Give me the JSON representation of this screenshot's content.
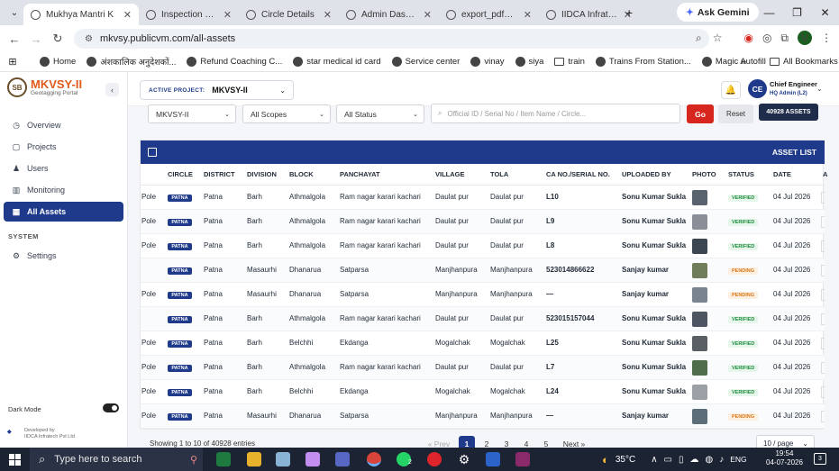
{
  "browser": {
    "tabs": [
      {
        "title": "Mukhya Mantri K",
        "active": true
      },
      {
        "title": "Inspection Data E",
        "active": false
      },
      {
        "title": "Circle Details",
        "active": false
      },
      {
        "title": "Admin Dashboar",
        "active": false
      },
      {
        "title": "export_pdf_waive",
        "active": false
      },
      {
        "title": "IIDCA Infratech P",
        "active": false
      }
    ],
    "new_tab_icon": "plus-icon",
    "gemini_label": "Ask Gemini",
    "url": "mkvsy.publicvm.com/all-assets",
    "profile_initial": "V",
    "bookmarks": [
      {
        "label": "Home",
        "icon": "globe"
      },
      {
        "label": "अंशकालिक अनुदेशकों...",
        "icon": "globe"
      },
      {
        "label": "Refund Coaching C...",
        "icon": "globe"
      },
      {
        "label": "star medical id card",
        "icon": "globe"
      },
      {
        "label": "Service center",
        "icon": "globe"
      },
      {
        "label": "vinay",
        "icon": "globe"
      },
      {
        "label": "siya",
        "icon": "globe"
      },
      {
        "label": "train",
        "icon": "folder"
      },
      {
        "label": "Trains From Station...",
        "icon": "globe"
      },
      {
        "label": "Magic Autofill",
        "icon": "globe"
      }
    ],
    "all_bookmarks": "All Bookmarks"
  },
  "app": {
    "logo_mark": "SB",
    "logo_name": "MKVSY-II",
    "logo_sub": "Geotagging Portal",
    "nav": [
      {
        "label": "Overview",
        "icon": "grid-icon",
        "active": false
      },
      {
        "label": "Projects",
        "icon": "folder-icon",
        "active": false
      },
      {
        "label": "Users",
        "icon": "users-icon",
        "active": false
      },
      {
        "label": "Monitoring",
        "icon": "chart-icon",
        "active": false
      },
      {
        "label": "All Assets",
        "icon": "layers-icon",
        "active": true
      }
    ],
    "system_section": "SYSTEM",
    "settings_label": "Settings",
    "dark_mode_label": "Dark Mode",
    "dev_line1": "Developed by",
    "dev_line2": "IIDCA Infratech Pvt Ltd",
    "active_project_label": "ACTIVE PROJECT:",
    "active_project_value": "MKVSY-II",
    "user_initials": "CE",
    "user_name": "Chief Engineer",
    "user_role": "HQ Admin (L2)"
  },
  "filters": {
    "project": "MKVSY-II",
    "scopes": "All Scopes",
    "status": "All Status",
    "search_placeholder": "Official ID / Serial No / Item Name / Circle...",
    "go_label": "Go",
    "reset_label": "Reset",
    "count_badge": "40928 ASSETS"
  },
  "table": {
    "title": "ASSET LIST",
    "columns": [
      "CIRCLE",
      "DISTRICT",
      "DIVISION",
      "BLOCK",
      "PANCHAYAT",
      "VILLAGE",
      "TOLA",
      "CA NO./SERIAL NO.",
      "UPLOADED BY",
      "PHOTO",
      "STATUS",
      "DATE",
      "A"
    ],
    "rows": [
      {
        "lead": "Pole",
        "circle": "PATNA",
        "district": "Patna",
        "division": "Barh",
        "block": "Athmalgola",
        "panchayat": "Ram nagar karari kachari",
        "village": "Daulat pur",
        "tola": "Daulat pur",
        "serial": "L10",
        "uploader": "Sonu Kumar Sukla",
        "status": "VERIFIED",
        "date": "04 Jul 2026"
      },
      {
        "lead": "Pole",
        "circle": "PATNA",
        "district": "Patna",
        "division": "Barh",
        "block": "Athmalgola",
        "panchayat": "Ram nagar karari kachari",
        "village": "Daulat pur",
        "tola": "Daulat pur",
        "serial": "L9",
        "uploader": "Sonu Kumar Sukla",
        "status": "VERIFIED",
        "date": "04 Jul 2026"
      },
      {
        "lead": "Pole",
        "circle": "PATNA",
        "district": "Patna",
        "division": "Barh",
        "block": "Athmalgola",
        "panchayat": "Ram nagar karari kachari",
        "village": "Daulat pur",
        "tola": "Daulat pur",
        "serial": "L8",
        "uploader": "Sonu Kumar Sukla",
        "status": "VERIFIED",
        "date": "04 Jul 2026"
      },
      {
        "lead": "",
        "circle": "PATNA",
        "district": "Patna",
        "division": "Masaurhi",
        "block": "Dhanarua",
        "panchayat": "Satparsa",
        "village": "Manjhanpura",
        "tola": "Manjhanpura",
        "serial": "523014866622",
        "uploader": "Sanjay kumar",
        "status": "PENDING",
        "date": "04 Jul 2026"
      },
      {
        "lead": "Pole",
        "circle": "PATNA",
        "district": "Patna",
        "division": "Masaurhi",
        "block": "Dhanarua",
        "panchayat": "Satparsa",
        "village": "Manjhanpura",
        "tola": "Manjhanpura",
        "serial": "—",
        "uploader": "Sanjay kumar",
        "status": "PENDING",
        "date": "04 Jul 2026"
      },
      {
        "lead": "",
        "circle": "PATNA",
        "district": "Patna",
        "division": "Barh",
        "block": "Athmalgola",
        "panchayat": "Ram nagar karari kachari",
        "village": "Daulat pur",
        "tola": "Daulat pur",
        "serial": "523015157044",
        "uploader": "Sonu Kumar Sukla",
        "status": "VERIFIED",
        "date": "04 Jul 2026"
      },
      {
        "lead": "Pole",
        "circle": "PATNA",
        "district": "Patna",
        "division": "Barh",
        "block": "Belchhi",
        "panchayat": "Ekdanga",
        "village": "Mogalchak",
        "tola": "Mogalchak",
        "serial": "L25",
        "uploader": "Sonu Kumar Sukla",
        "status": "VERIFIED",
        "date": "04 Jul 2026"
      },
      {
        "lead": "Pole",
        "circle": "PATNA",
        "district": "Patna",
        "division": "Barh",
        "block": "Athmalgola",
        "panchayat": "Ram nagar karari kachari",
        "village": "Daulat pur",
        "tola": "Daulat pur",
        "serial": "L7",
        "uploader": "Sonu Kumar Sukla",
        "status": "VERIFIED",
        "date": "04 Jul 2026"
      },
      {
        "lead": "Pole",
        "circle": "PATNA",
        "district": "Patna",
        "division": "Barh",
        "block": "Belchhi",
        "panchayat": "Ekdanga",
        "village": "Mogalchak",
        "tola": "Mogalchak",
        "serial": "L24",
        "uploader": "Sonu Kumar Sukla",
        "status": "VERIFIED",
        "date": "04 Jul 2026"
      },
      {
        "lead": "Pole",
        "circle": "PATNA",
        "district": "Patna",
        "division": "Masaurhi",
        "block": "Dhanarua",
        "panchayat": "Satparsa",
        "village": "Manjhanpura",
        "tola": "Manjhanpura",
        "serial": "—",
        "uploader": "Sanjay kumar",
        "status": "PENDING",
        "date": "04 Jul 2026"
      }
    ],
    "footer_info": "Showing 1 to 10 of 40928 entries",
    "pager": {
      "prev": "« Prev",
      "pages": [
        "1",
        "2",
        "3",
        "4",
        "5"
      ],
      "next": "Next »",
      "current": "1"
    },
    "per_page": "10 / page"
  },
  "taskbar": {
    "search_placeholder": "Type here to search",
    "weather": "35°C",
    "lang": "ENG",
    "time": "19:54",
    "date": "04-07-2026",
    "notif_count": "3",
    "whatsapp_badge": "2"
  }
}
